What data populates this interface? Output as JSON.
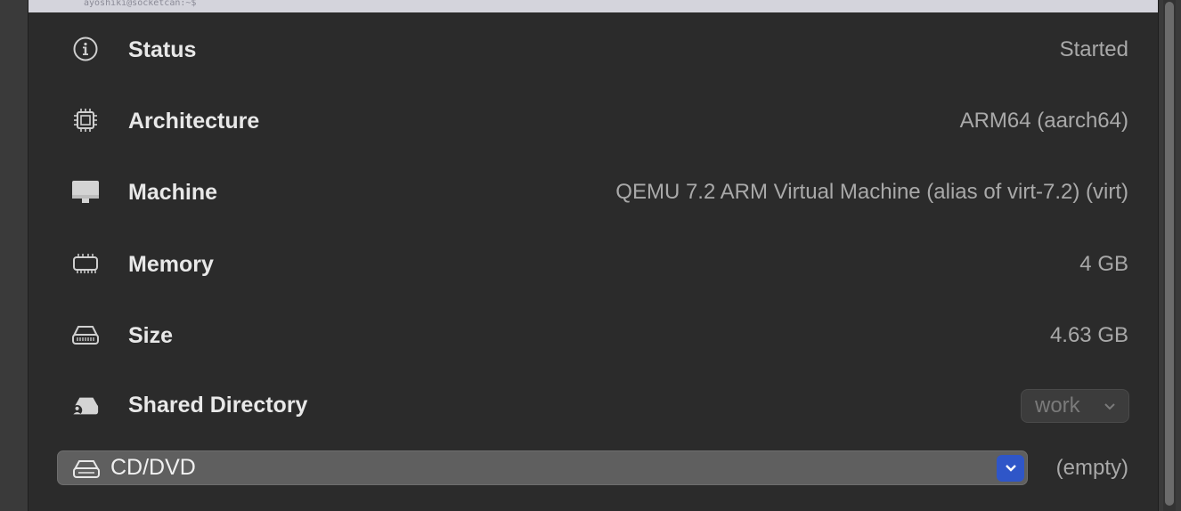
{
  "terminal": {
    "prompt": "ayoshiki@socketcan:~$"
  },
  "rows": [
    {
      "label": "Status",
      "value": "Started",
      "icon": "info-circle-icon"
    },
    {
      "label": "Architecture",
      "value": "ARM64 (aarch64)",
      "icon": "cpu-chip-icon"
    },
    {
      "label": "Machine",
      "value": "QEMU 7.2 ARM Virtual Machine (alias of virt-7.2) (virt)",
      "icon": "display-monitor-icon"
    },
    {
      "label": "Memory",
      "value": "4 GB",
      "icon": "memory-module-icon"
    },
    {
      "label": "Size",
      "value": "4.63 GB",
      "icon": "hard-drive-icon"
    }
  ],
  "shared_directory": {
    "label": "Shared Directory",
    "selected": "work",
    "icon": "shared-drive-icon"
  },
  "cd_dvd": {
    "label": "CD/DVD",
    "value": "(empty)",
    "icon": "optical-drive-icon"
  },
  "colors": {
    "background": "#2b2b2b",
    "label": "#e8e8e8",
    "value": "#a9a9a9",
    "accent": "#2f56c8"
  }
}
